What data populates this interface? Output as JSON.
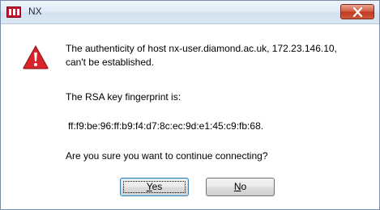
{
  "window": {
    "title": "NX"
  },
  "message": {
    "line1": "The authenticity of host nx-user.diamond.ac.uk, 172.23.146.10,",
    "line2": "can't be established.",
    "fingerprint_label": "The RSA key fingerprint is:",
    "fingerprint": "ff:f9:be:96:ff:b9:f4:d7:8c:ec:9d:e1:45:c9:fb:68.",
    "question": "Are you sure you want to continue connecting?"
  },
  "buttons": {
    "yes": {
      "mnemonic": "Y",
      "rest": "es"
    },
    "no": {
      "mnemonic": "N",
      "rest": "o"
    }
  },
  "icons": {
    "app": "nx-app-icon",
    "warning": "warning-icon",
    "close": "close-icon"
  },
  "colors": {
    "app_icon": "#c8102e",
    "warning": "#d8232a",
    "close_button": "#c23a1f"
  }
}
